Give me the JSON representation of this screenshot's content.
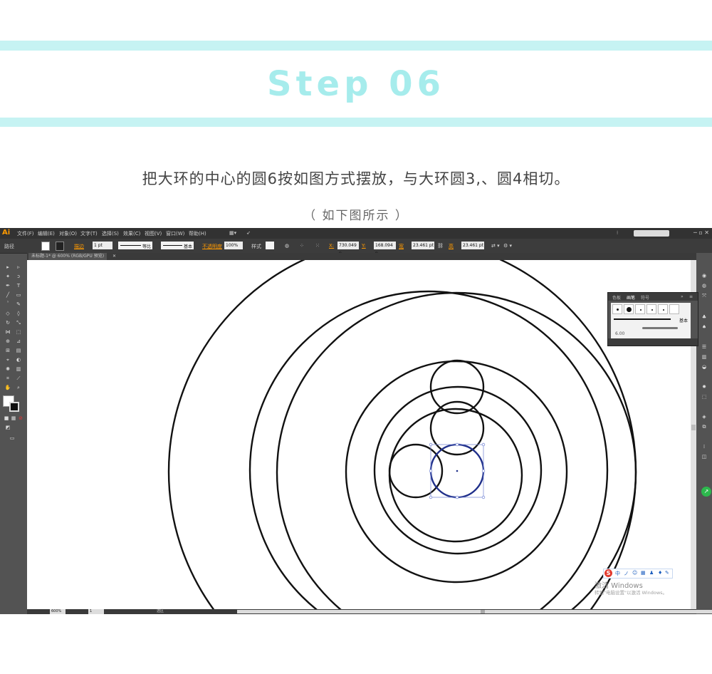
{
  "header": {
    "title": "Step 06",
    "description": "把大环的中心的圆6按如图方式摆放，与大环圆3,、圆4相切。",
    "note": "（ 如下图所示 ）",
    "band_color": "#c6f3f3",
    "title_color": "#a6ecec"
  },
  "app": {
    "logo": "Ai",
    "menus": [
      "文件(F)",
      "编辑(E)",
      "对象(O)",
      "文字(T)",
      "选择(S)",
      "效果(C)",
      "视图(V)",
      "窗口(W)",
      "帮助(H)"
    ],
    "control": {
      "context_label": "路径",
      "stroke_label": "描边",
      "stroke_value": "1 pt",
      "profile_label": "等比",
      "brush_label": "基本",
      "opacity_label": "不透明度",
      "opacity_value": "100%",
      "style_label": "样式",
      "x_value": "730.049 p",
      "y_value": "168.094 p",
      "w_label": "宽",
      "w_value": "23.461 pt",
      "h_label": "高",
      "h_value": "23.461 pt"
    },
    "document_tab": "未标题-1* @ 600% (RGB/GPU 预览)",
    "status": {
      "zoom": "600%",
      "page": "1",
      "tool": "选区"
    },
    "brush_panel": {
      "tabs": [
        "色板",
        "画笔",
        "符号"
      ],
      "active_tab": "画笔",
      "basic_label": "基本",
      "size_value": "6.00"
    },
    "accent_color": "#ff9a00",
    "selection_color": "#1f2f8a"
  },
  "watermark": {
    "title": "激活 Windows",
    "subtitle": "转到\"电脑设置\"以激活 Windows。",
    "ime_logo": "S",
    "ime_icons": [
      "中",
      "ノ",
      "☺",
      "▦",
      "♟",
      "♦",
      "✎"
    ]
  }
}
